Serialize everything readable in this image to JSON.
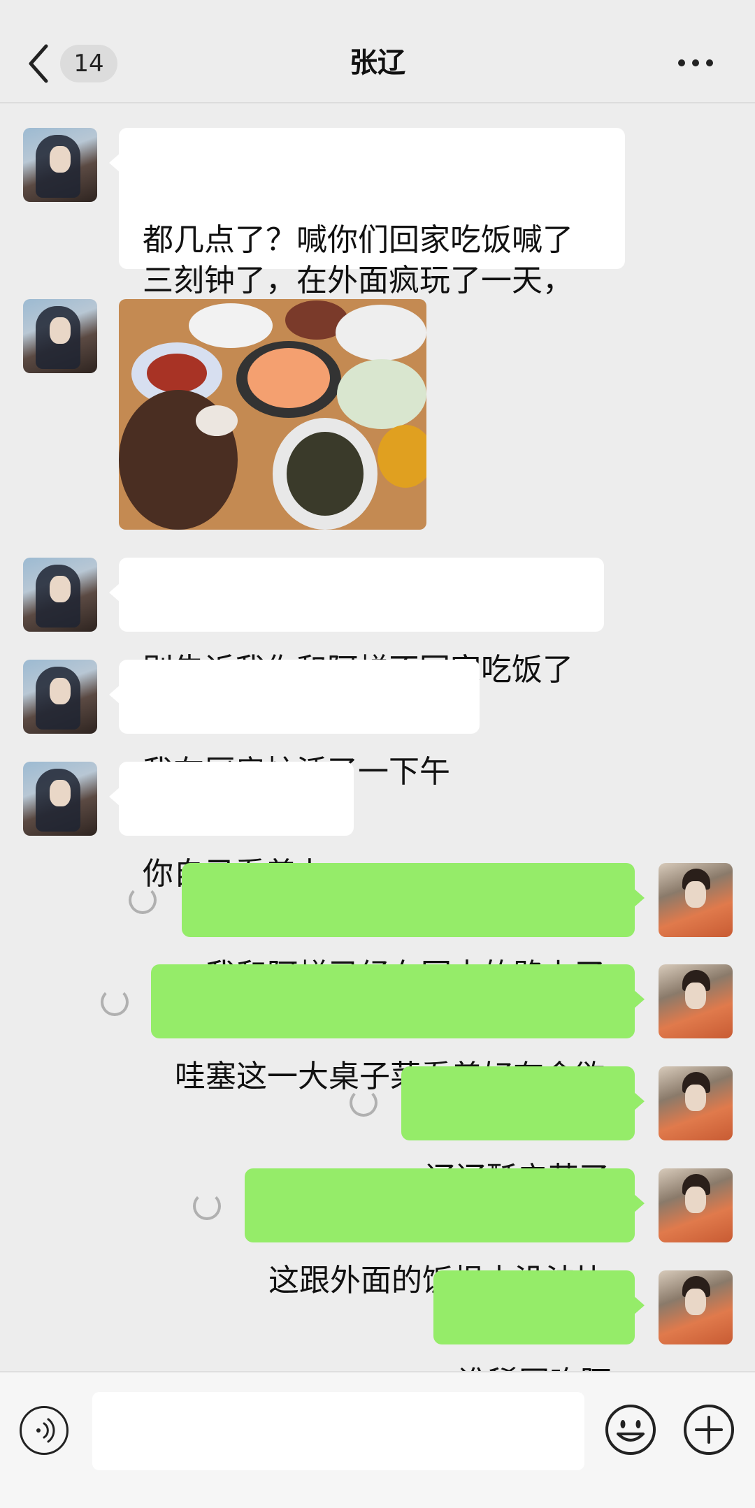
{
  "header": {
    "unread_count": "14",
    "title": "张辽"
  },
  "messages": [
    {
      "side": "left",
      "type": "text",
      "text": "都几点了？喊你们回家吃饭喊了\n三刻钟了，在外面疯玩了一天，\n人呢？"
    },
    {
      "side": "left",
      "type": "image",
      "description": "food-photo"
    },
    {
      "side": "left",
      "type": "text",
      "text": "别告诉我你和阿蝉不回家吃饭了"
    },
    {
      "side": "left",
      "type": "text",
      "text": "我在厨房忙活了一下午"
    },
    {
      "side": "left",
      "type": "text",
      "text": "你自己看着办"
    },
    {
      "side": "right",
      "type": "text",
      "text": "我和阿蝉已经在回去的路上了",
      "sending": true
    },
    {
      "side": "right",
      "type": "text",
      "text": "哇塞这一大桌子菜看着好有食欲",
      "sending": true
    },
    {
      "side": "right",
      "type": "text",
      "text": "辽辽酥辛苦了",
      "sending": true
    },
    {
      "side": "right",
      "type": "text",
      "text": "这跟外面的饭根本没法比",
      "sending": true
    },
    {
      "side": "right",
      "type": "text",
      "text": "谁稀罕吃阿",
      "sending": false
    }
  ],
  "input": {
    "value": "",
    "placeholder": ""
  },
  "colors": {
    "background": "#ededed",
    "bubble_left": "#ffffff",
    "bubble_right": "#95ec69",
    "input_bar": "#f6f6f6"
  },
  "icons": {
    "back": "chevron-left-icon",
    "more": "more-dots-icon",
    "voice": "voice-icon",
    "emoji": "emoji-icon",
    "plus": "plus-icon"
  }
}
